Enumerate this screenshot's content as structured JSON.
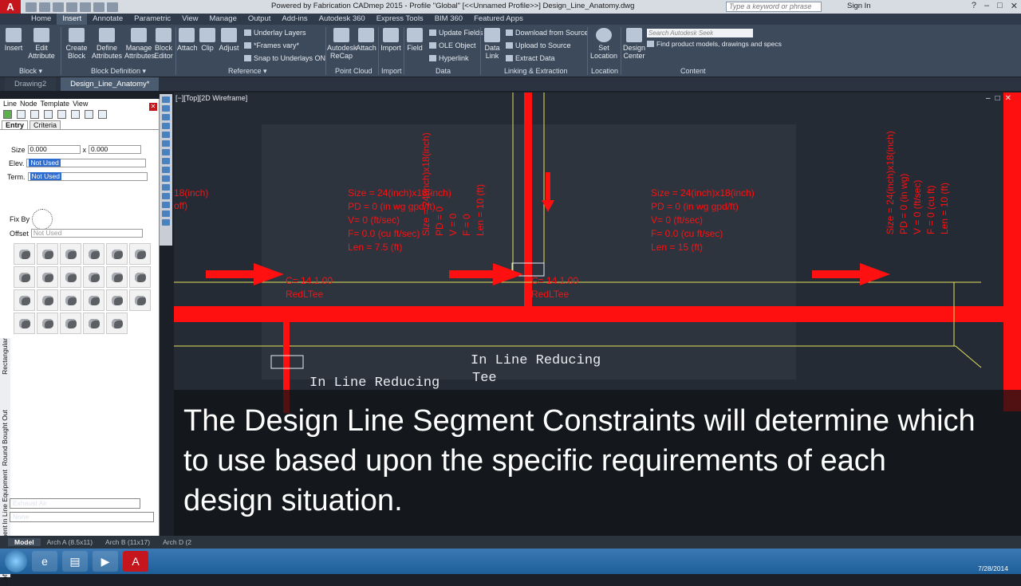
{
  "window": {
    "app_logo": "A",
    "title": "Powered by Fabrication CADmep 2015 - Profile \"Global\"  [<<Unnamed Profile>>]    Design_Line_Anatomy.dwg",
    "search_placeholder": "Type a keyword or phrase",
    "sign_in": "Sign In"
  },
  "ribbon_tabs": [
    "Home",
    "Insert",
    "Annotate",
    "Parametric",
    "View",
    "Manage",
    "Output",
    "Add-ins",
    "Autodesk 360",
    "Express Tools",
    "BIM 360",
    "Featured Apps"
  ],
  "active_ribbon_tab": "Insert",
  "ribbon": {
    "insert": "Insert",
    "edit_attribute": "Edit\nAttribute",
    "create_block": "Create\nBlock",
    "define_attributes": "Define\nAttributes",
    "manage_attributes": "Manage\nAttributes",
    "block_editor": "Block\nEditor",
    "attach": "Attach",
    "clip": "Clip",
    "adjust": "Adjust",
    "underlay_layers": "Underlay Layers",
    "frames_vary": "*Frames vary*",
    "snap_underlays": "Snap to Underlays ON",
    "recap": "Autodesk\nReCap",
    "attach2": "Attach",
    "import": "Import",
    "field": "Field",
    "update_fields": "Update Fields",
    "ole_object": "OLE Object",
    "hyperlink": "Hyperlink",
    "data_link": "Data\nLink",
    "download_source": "Download from Source",
    "upload_source": "Upload to Source",
    "extract_data": "Extract  Data",
    "set_location": "Set\nLocation",
    "design_center": "Design\nCenter",
    "seek_placeholder": "Search Autodesk Seek",
    "seek_text": "Find product models, drawings and specs",
    "panels": {
      "block": "Block ▾",
      "block_definition": "Block Definition ▾",
      "reference": "Reference ▾",
      "point_cloud": "Point Cloud",
      "import": "Import",
      "data": "Data",
      "linking": "Linking & Extraction",
      "location": "Location",
      "content": "Content"
    }
  },
  "doc_tabs": [
    "Drawing2",
    "Design_Line_Anatomy*"
  ],
  "active_doc_tab": "Design_Line_Anatomy*",
  "left_panel": {
    "menu": [
      "Line",
      "Node",
      "Template",
      "View"
    ],
    "tabs": [
      "Entry",
      "Criteria"
    ],
    "active_tab": "Entry",
    "size_label": "Size",
    "size_x": "0.000",
    "x_label": "x",
    "size_y": "0.000",
    "elev_label": "Elev.",
    "elev_value": "Not Used",
    "term_label": "Term.",
    "term_value": "Not Used",
    "fix_by_label": "Fix By",
    "offset_label": "Offset",
    "offset_value": "Not Used",
    "vertical_tabs": [
      "Rectangular",
      "Round Bought Out",
      "In Line Equipment",
      "...of Line Equipment"
    ],
    "service": "Exhaust Air",
    "none": "None"
  },
  "viewport": {
    "label": "[−][Top][2D Wireframe]",
    "annotations": {
      "left_partial_1": "18(inch)",
      "left_partial_2": "off)",
      "center_block": [
        "Size = 24(inch)x18(inch)",
        "PD = 0 (in wg gpd/ft)",
        "V= 0 (ft/sec)",
        "F= 0.0 (cu ft/sec)",
        "Len = 7.5 (ft)"
      ],
      "right_block": [
        "Size = 24(inch)x18(inch)",
        "PD = 0 (in wg gpd/ft)",
        "V= 0 (ft/sec)",
        "F= 0.0 (cu ft/sec)",
        "Len = 15 (ft)"
      ],
      "vertical_block_center": [
        "Size = 24(inch)x18(inch)",
        "PD = 0",
        "V = 0",
        "F = 0",
        "Len = 10 (ft)"
      ],
      "vertical_block_right": [
        "Size = 24(inch)x18(inch)",
        "PD = 0 (in wg)",
        "V = 0 (ft/sec)",
        "F = 0 (cu ft)",
        "Len = 10 (ft)"
      ],
      "tee_label_1": [
        "C= 14.1.00",
        "RedLTee"
      ],
      "tee_label_2": [
        "C= 14.1.00",
        "RedLTee"
      ],
      "in_line_1": "In  Line  Reducing",
      "in_line_2": "In  Line  Reducing",
      "tee_word": "Tee"
    }
  },
  "caption": "The Design Line Segment Constraints will determine which to use based upon the specific requirements of each design situation.",
  "layout_tabs": [
    "Model",
    "Arch A (8.5x11)",
    "Arch B (11x17)",
    "Arch D (2"
  ],
  "active_layout_tab": "Model",
  "taskbar": {
    "date": "7/28/2014"
  },
  "colors": {
    "duct_red": "#ff1010",
    "frame_yellow": "#e8e05a",
    "viewport_bg": "#242b35",
    "ribbon_bg": "#3d4a5b"
  }
}
